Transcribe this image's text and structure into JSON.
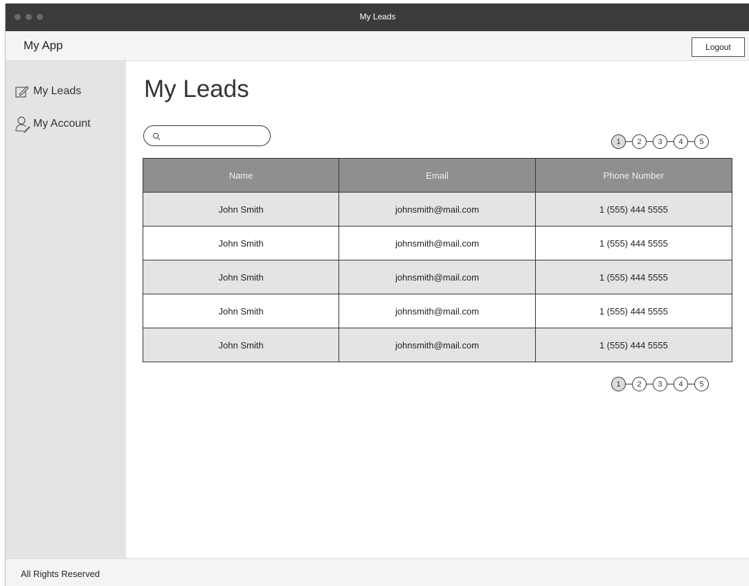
{
  "window": {
    "title": "My Leads"
  },
  "appbar": {
    "title": "My App",
    "logout_label": "Logout"
  },
  "sidebar": {
    "items": [
      {
        "label": "My Leads",
        "icon": "edit-icon"
      },
      {
        "label": "My Account",
        "icon": "user-icon"
      }
    ]
  },
  "main": {
    "title": "My Leads",
    "search": {
      "placeholder": "",
      "value": ""
    },
    "pagination": {
      "pages": [
        "1",
        "2",
        "3",
        "4",
        "5"
      ],
      "current": "1"
    },
    "table": {
      "columns": [
        "Name",
        "Email",
        "Phone Number"
      ],
      "rows": [
        [
          "John Smith",
          "johnsmith@mail.com",
          "1 (555) 444 5555"
        ],
        [
          "John Smith",
          "johnsmith@mail.com",
          "1 (555) 444 5555"
        ],
        [
          "John Smith",
          "johnsmith@mail.com",
          "1 (555) 444 5555"
        ],
        [
          "John Smith",
          "johnsmith@mail.com",
          "1 (555) 444 5555"
        ],
        [
          "John Smith",
          "johnsmith@mail.com",
          "1 (555) 444 5555"
        ]
      ]
    }
  },
  "footer": {
    "text": "All Rights Reserved"
  },
  "colors": {
    "titlebar": "#3b3b3b",
    "sidebar": "#e4e4e4",
    "table_header": "#8f8f8f",
    "row_alt": "#e4e4e4"
  }
}
